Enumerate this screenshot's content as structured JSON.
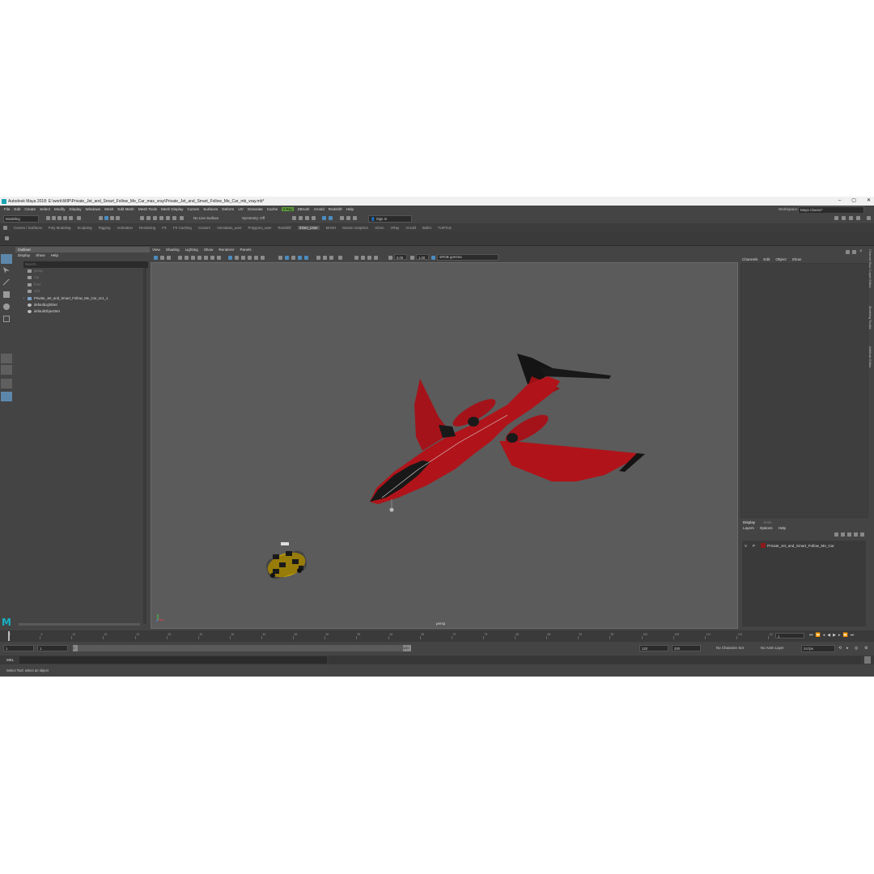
{
  "window": {
    "title": "Autodesk Maya 2018: E:\\work\\WIP\\Private_Jet_and_Smart_Follow_Me_Car_max_vray\\Private_Jet_and_Smart_Follow_Me_Car_mb_vray.mb*",
    "controls": [
      "–",
      "▢",
      "✕"
    ]
  },
  "menubar": {
    "items": [
      "File",
      "Edit",
      "Create",
      "Select",
      "Modify",
      "Display",
      "Windows",
      "Mesh",
      "Edit Mesh",
      "Mesh Tools",
      "Mesh Display",
      "Curves",
      "Surfaces",
      "Deform",
      "UV",
      "Generate",
      "Cache",
      "V-Ray",
      "ZBrush",
      "Arnold",
      "Redshift",
      "Help"
    ],
    "highlighted": "V-Ray",
    "workspace_label": "Workspace :",
    "workspace_value": "Maya Classic*"
  },
  "statusline": {
    "mode": "Modeling",
    "live_surface": "No Live Surface",
    "symmetry": "Symmetry: Off",
    "sign_in": "Sign In"
  },
  "shelf": {
    "tabs": [
      "Curves / Surfaces",
      "Poly Modeling",
      "Sculpting",
      "Rigging",
      "Animation",
      "Rendering",
      "FX",
      "FX Caching",
      "Custom",
      "Animation_user",
      "Polygons_user",
      "Redshift",
      "XGen_User",
      "MASH",
      "Motion Graphics",
      "XGen",
      "VRay",
      "Arnold",
      "Bullet",
      "TURTLE"
    ],
    "active": "XGen_User"
  },
  "outliner": {
    "title": "Outliner",
    "menu": [
      "Display",
      "Show",
      "Help"
    ],
    "search_placeholder": "Search...",
    "items": [
      {
        "label": "persp",
        "dim": true,
        "expand": ""
      },
      {
        "label": "top",
        "dim": true,
        "expand": ""
      },
      {
        "label": "front",
        "dim": true,
        "expand": ""
      },
      {
        "label": "side",
        "dim": true,
        "expand": ""
      },
      {
        "label": "Private_Jet_and_Smart_Follow_Me_Car_nc1_1",
        "dim": false,
        "expand": "+"
      },
      {
        "label": "defaultLightSet",
        "dim": false,
        "expand": ""
      },
      {
        "label": "defaultObjectSet",
        "dim": false,
        "expand": ""
      }
    ]
  },
  "viewport": {
    "menu": [
      "View",
      "Shading",
      "Lighting",
      "Show",
      "Renderer",
      "Panels"
    ],
    "exposure": "0.00",
    "gamma": "1.00",
    "color_space": "sRGB gamma",
    "camera_label": "persp"
  },
  "channel_box": {
    "menu": [
      "Channels",
      "Edit",
      "Object",
      "Show"
    ]
  },
  "layers": {
    "tabs": [
      "Display",
      "Anim"
    ],
    "menu": [
      "Layers",
      "Options",
      "Help"
    ],
    "layer": {
      "v": "V",
      "p": "P",
      "name": "Private_Jet_and_Smart_Follow_Me_Car",
      "color": "#8c1a1a"
    }
  },
  "side_tabs": [
    "Channel Box / Layer Editor",
    "Modeling Toolkit",
    "Attribute Editor"
  ],
  "timeline": {
    "tick_labels": [
      "1",
      "5",
      "10",
      "15",
      "20",
      "25",
      "30",
      "35",
      "40",
      "45",
      "50",
      "55",
      "60",
      "65",
      "70",
      "75",
      "80",
      "85",
      "90",
      "95",
      "100",
      "105",
      "110",
      "115",
      "120"
    ],
    "current_frame": "1"
  },
  "range": {
    "start": "1",
    "start_inner": "1",
    "slider_start": "1",
    "slider_end": "120",
    "end_inner": "120",
    "end": "200",
    "character_set": "No Character Set",
    "anim_layer": "No Anim Layer",
    "fps": "24 fps"
  },
  "command": {
    "lang": "MEL"
  },
  "help_line": "Select Tool: select an object",
  "colors": {
    "jet_body": "#b0141a",
    "jet_dark": "#1a1a1a",
    "car_yellow": "#d9b000",
    "maya_logo": "#15b2c4"
  }
}
